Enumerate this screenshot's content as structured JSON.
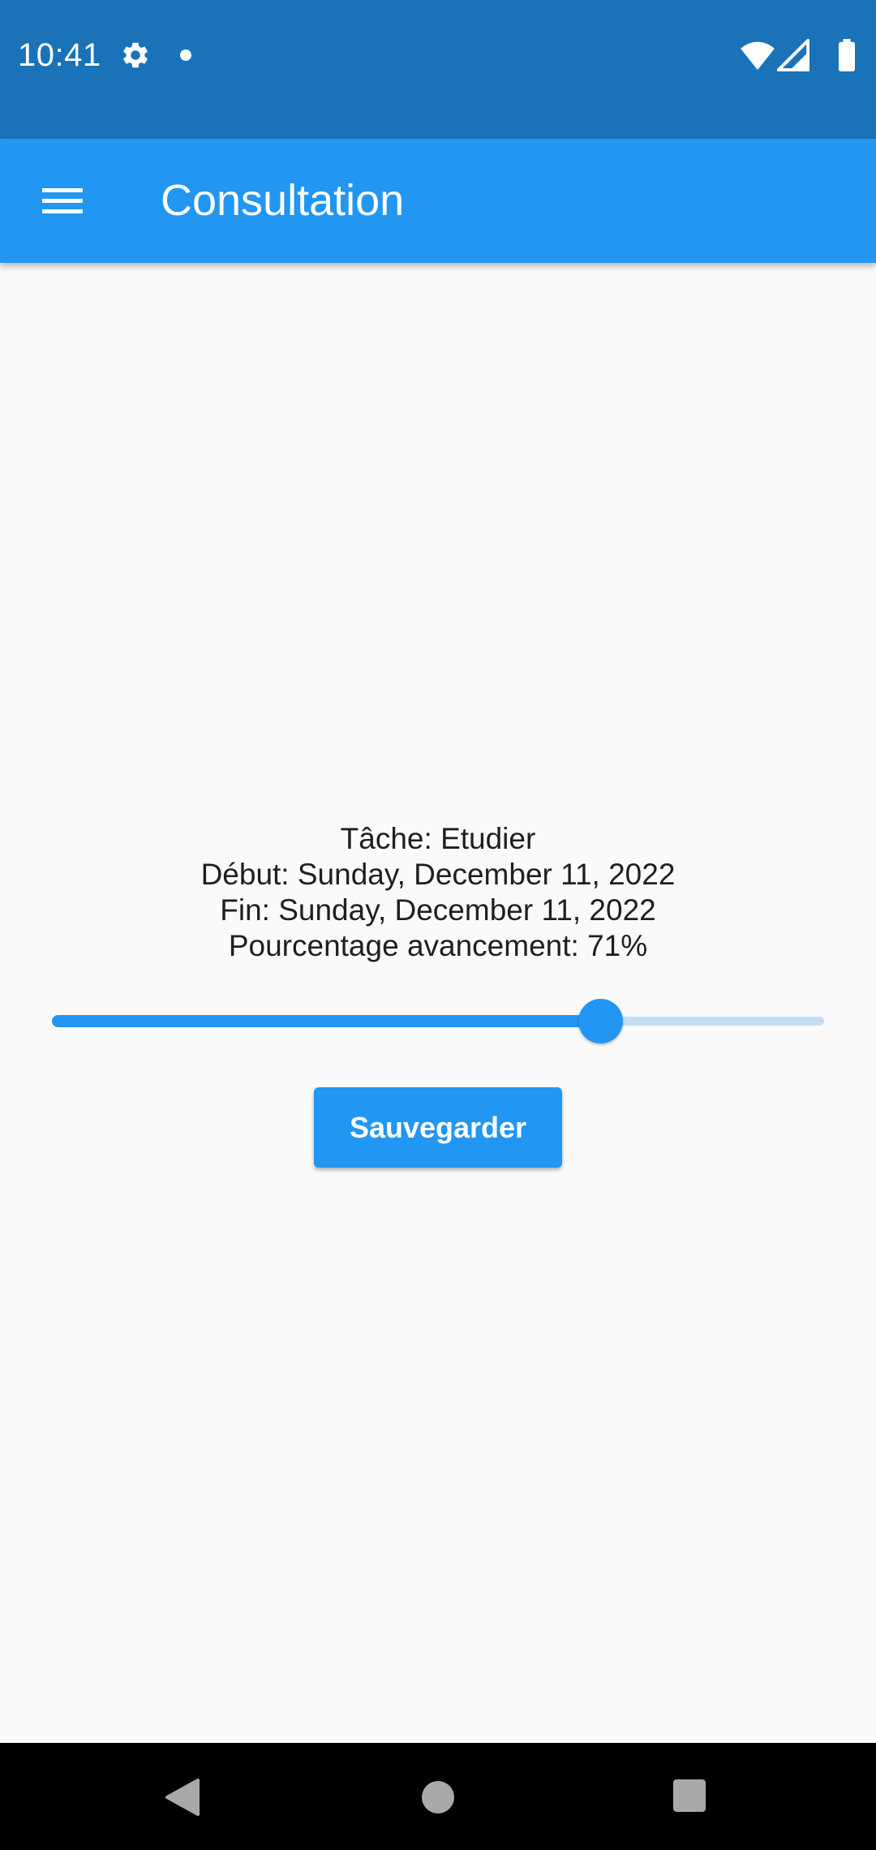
{
  "status_bar": {
    "time": "10:41",
    "icons": [
      "gear-icon",
      "notification-dot-icon",
      "wifi-icon",
      "signal-icon",
      "battery-icon"
    ],
    "background_color": "#1a72b9"
  },
  "app_bar": {
    "title": "Consultation",
    "menu_icon": "hamburger-menu-icon",
    "background_color": "#2196f3"
  },
  "task": {
    "name_line": "Tâche: Etudier",
    "start_line": "Début: Sunday, December 11, 2022",
    "end_line": "Fin: Sunday, December 11, 2022",
    "progress_line": "Pourcentage avancement: 71%"
  },
  "progress_slider": {
    "value": 0.71,
    "active_color": "#2196f3",
    "inactive_color": "#c3dff8"
  },
  "actions": {
    "save_label": "Sauvegarder"
  },
  "nav_bar": {
    "icons": [
      "back-icon",
      "home-icon",
      "recents-icon"
    ]
  }
}
